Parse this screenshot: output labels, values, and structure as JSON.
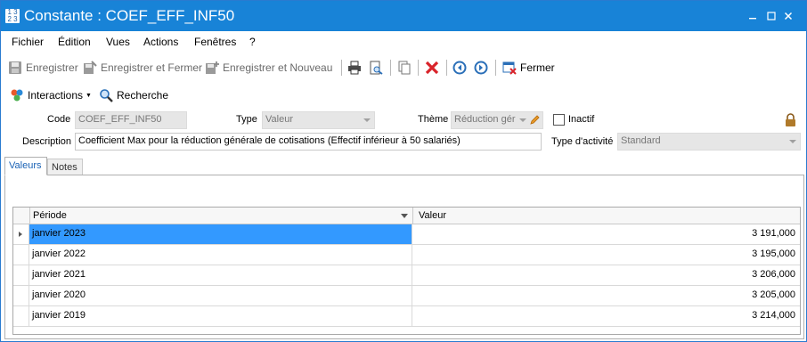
{
  "window": {
    "title": "Constante : COEF_EFF_INF50",
    "app_icon": "numbers-icon"
  },
  "menu": [
    "Fichier",
    "Édition",
    "Vues",
    "Actions",
    "Fenêtres",
    "?"
  ],
  "toolbar": {
    "save": "Enregistrer",
    "save_close": "Enregistrer et Fermer",
    "save_new": "Enregistrer et Nouveau",
    "close": "Fermer"
  },
  "toolbar2": {
    "interactions": "Interactions",
    "search": "Recherche"
  },
  "form": {
    "code_label": "Code",
    "code_value": "COEF_EFF_INF50",
    "type_label": "Type",
    "type_value": "Valeur",
    "theme_label": "Thème",
    "theme_value": "Réduction gér",
    "inactive_label": "Inactif",
    "description_label": "Description",
    "description_value": "Coefficient Max pour la réduction générale de cotisations (Effectif inférieur à 50 salariés)",
    "activity_label": "Type d'activité",
    "activity_value": "Standard"
  },
  "tabs": [
    "Valeurs",
    "Notes"
  ],
  "grid": {
    "columns": [
      "Période",
      "Valeur"
    ],
    "rows": [
      {
        "period": "janvier 2023",
        "value": "3 191,000"
      },
      {
        "period": "janvier 2022",
        "value": "3 195,000"
      },
      {
        "period": "janvier 2021",
        "value": "3 206,000"
      },
      {
        "period": "janvier 2020",
        "value": "3 205,000"
      },
      {
        "period": "janvier 2019",
        "value": "3 214,000"
      }
    ]
  },
  "colors": {
    "titlebar": "#1883d7",
    "selection": "#3399ff",
    "delete_red": "#d9232a",
    "nav_blue": "#2a6fb8"
  }
}
